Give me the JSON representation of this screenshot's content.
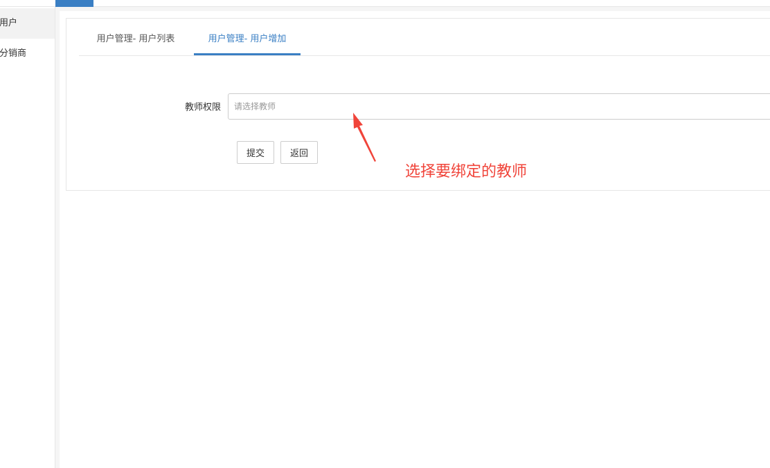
{
  "sidebar": {
    "items": [
      {
        "label": "用户",
        "active": true
      },
      {
        "label": "分销商",
        "active": false
      }
    ]
  },
  "tabs": [
    {
      "label": "用户管理- 用户列表",
      "active": false
    },
    {
      "label": "用户管理- 用户增加",
      "active": true
    }
  ],
  "form": {
    "teacher_label": "教师权限",
    "teacher_placeholder": "请选择教师",
    "teacher_value": ""
  },
  "buttons": {
    "submit_label": "提交",
    "back_label": "返回"
  },
  "annotation": {
    "text": "选择要绑定的教师",
    "color": "#f0443a"
  },
  "colors": {
    "accent": "#3a7fc4"
  }
}
